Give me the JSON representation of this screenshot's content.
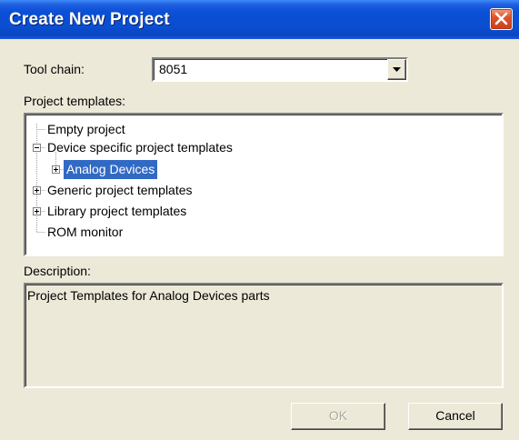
{
  "window": {
    "title": "Create New Project"
  },
  "toolchain": {
    "label": "Tool chain:",
    "value": "8051"
  },
  "templates": {
    "label": "Project templates:",
    "items": [
      {
        "label": "Empty project",
        "expander": "none"
      },
      {
        "label": "Device specific project templates",
        "expander": "minus"
      },
      {
        "label": "Analog Devices",
        "expander": "plus",
        "selected": true
      },
      {
        "label": "Generic project templates",
        "expander": "plus"
      },
      {
        "label": "Library project templates",
        "expander": "plus"
      },
      {
        "label": "ROM monitor",
        "expander": "none"
      }
    ]
  },
  "description": {
    "label": "Description:",
    "text": "Project Templates for Analog Devices parts"
  },
  "buttons": {
    "ok": "OK",
    "cancel": "Cancel"
  },
  "colors": {
    "titlebar": "#0a4fd6",
    "selection": "#316ac5",
    "dialog_bg": "#ece9d8"
  }
}
